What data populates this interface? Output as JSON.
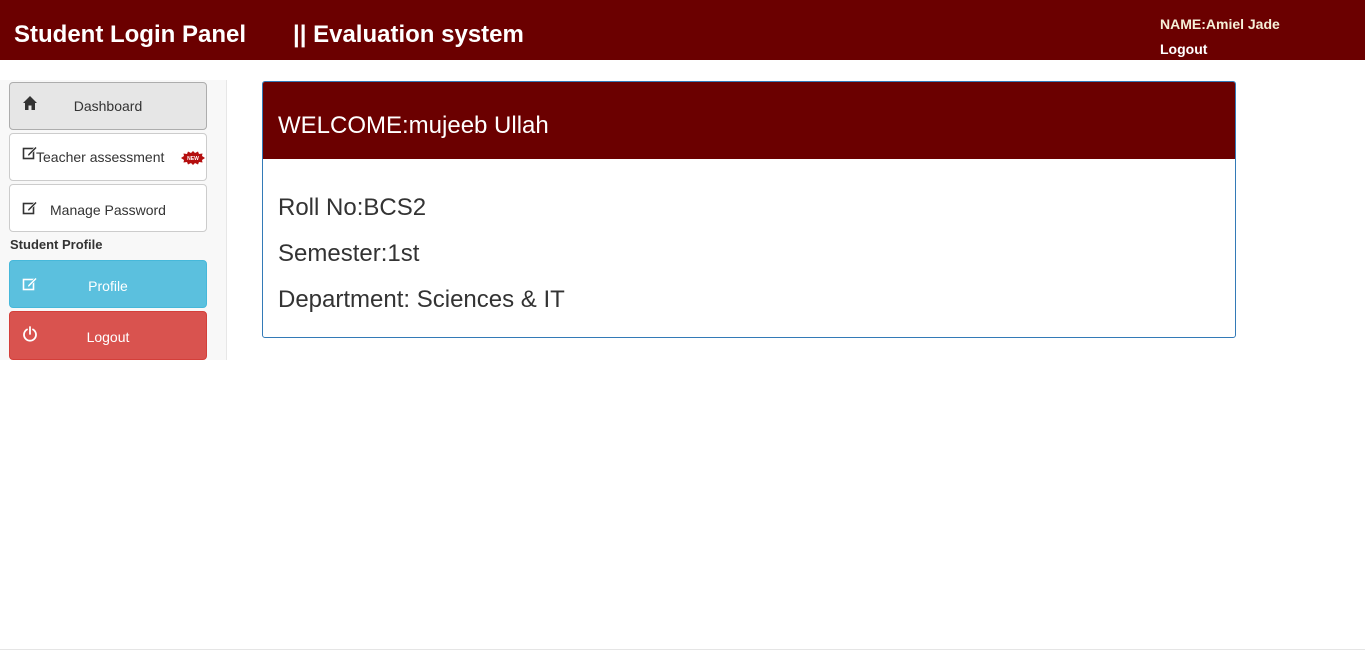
{
  "header": {
    "brand": "Student Login Panel",
    "subtitle": "|| Evaluation system",
    "user_name": "NAME:Amiel Jade",
    "logout": "Logout"
  },
  "sidebar": {
    "items": [
      {
        "label": "Dashboard",
        "icon": "home-icon"
      },
      {
        "label": "Teacher assessment",
        "icon": "edit-icon",
        "badge": "NEW"
      },
      {
        "label": "Manage Password",
        "icon": "edit-icon"
      }
    ],
    "section_title": "Student Profile",
    "profile_label": "Profile",
    "logout_label": "Logout"
  },
  "panel": {
    "welcome": "WELCOME:mujeeb Ullah",
    "roll_no": "Roll No:BCS2",
    "semester": "Semester:1st",
    "department": "Department: Sciences & IT"
  },
  "colors": {
    "header_bg": "#6b0000",
    "info_button": "#5bc0de",
    "danger_button": "#d9534f",
    "panel_border": "#337ab7"
  }
}
